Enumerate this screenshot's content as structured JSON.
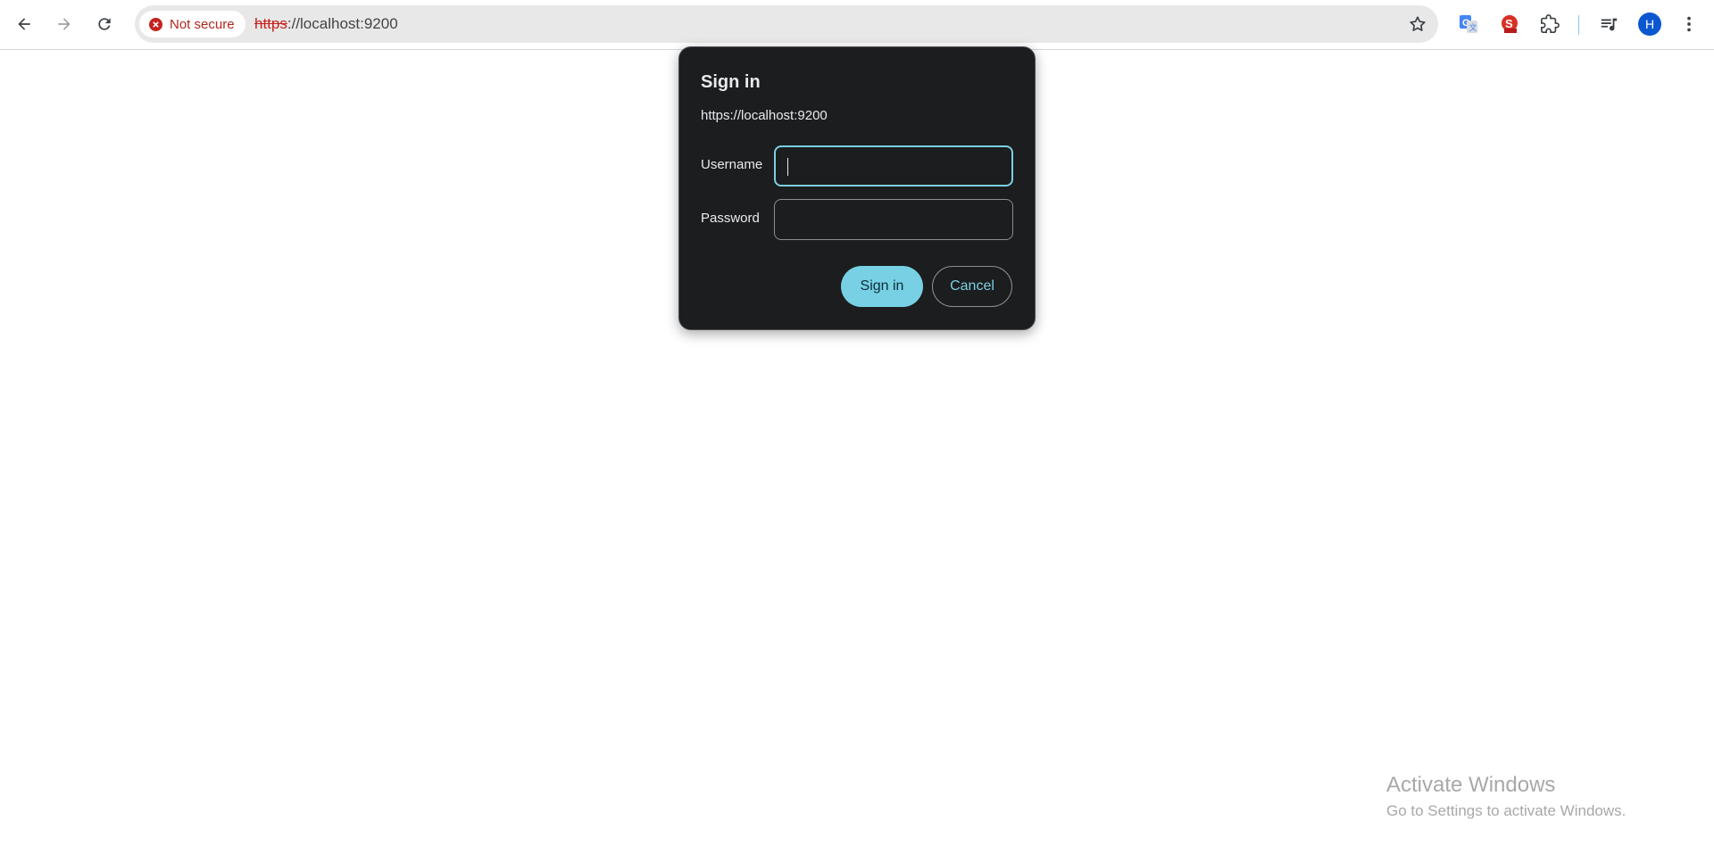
{
  "browser": {
    "security_label": "Not secure",
    "url_scheme": "https",
    "url_rest": "://localhost:9200",
    "icons": {
      "back": "back-arrow-icon",
      "forward": "forward-arrow-icon",
      "reload": "reload-icon",
      "security": "error-circle-icon",
      "bookmark": "star-icon",
      "translate": "google-translate-icon",
      "seo": "seo-extension-icon",
      "extensions": "puzzle-icon",
      "media": "media-queue-icon",
      "menu": "kebab-menu-icon"
    },
    "profile_initial": "H",
    "colors": {
      "profile_bg": "#0b57d0",
      "not_secure": "#c5221f"
    }
  },
  "dialog": {
    "title": "Sign in",
    "origin": "https://localhost:9200",
    "username_label": "Username",
    "username_value": "",
    "password_label": "Password",
    "password_value": "",
    "sign_in_label": "Sign in",
    "cancel_label": "Cancel",
    "colors": {
      "background": "#1b1d1f",
      "accent": "#78d0e4"
    }
  },
  "watermark": {
    "title": "Activate Windows",
    "subtitle": "Go to Settings to activate Windows."
  }
}
